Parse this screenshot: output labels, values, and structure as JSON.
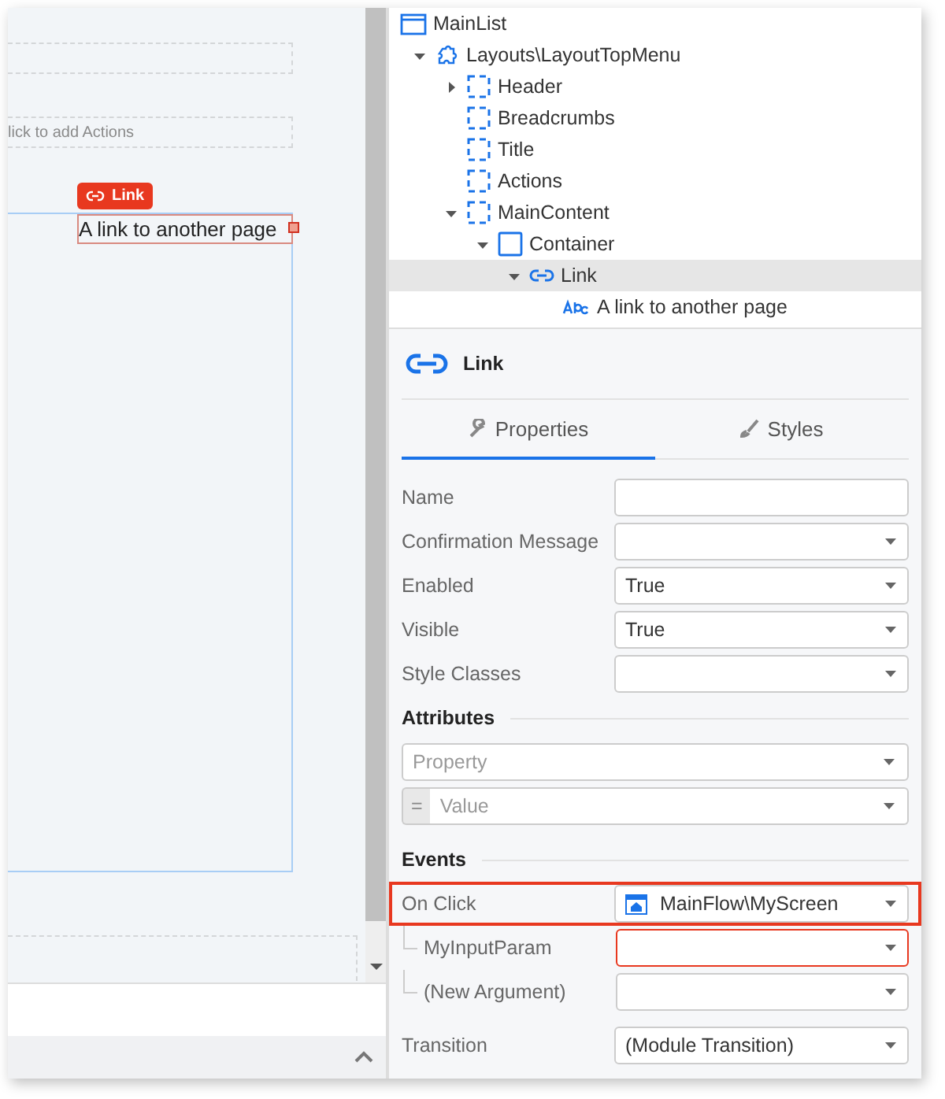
{
  "canvas": {
    "actions_hint": "lick to add Actions",
    "badge": "Link",
    "link_text": "A link to another page"
  },
  "tree": [
    {
      "label": "MainList",
      "kind": "screen",
      "selected": false,
      "children": [
        {
          "label": "Layouts\\LayoutTopMenu",
          "kind": "block",
          "expanded": true,
          "selected": false,
          "children": [
            {
              "label": "Header",
              "kind": "placeholder",
              "expanded": false,
              "selected": false
            },
            {
              "label": "Breadcrumbs",
              "kind": "placeholder",
              "selected": false
            },
            {
              "label": "Title",
              "kind": "placeholder",
              "selected": false
            },
            {
              "label": "Actions",
              "kind": "placeholder",
              "selected": false
            },
            {
              "label": "MainContent",
              "kind": "placeholder",
              "expanded": true,
              "selected": false,
              "children": [
                {
                  "label": "Container",
                  "kind": "container",
                  "expanded": true,
                  "selected": false,
                  "children": [
                    {
                      "label": "Link",
                      "kind": "link",
                      "expanded": true,
                      "selected": true,
                      "children": [
                        {
                          "label": "A link to another page",
                          "kind": "text",
                          "selected": false
                        }
                      ]
                    }
                  ]
                }
              ]
            }
          ]
        }
      ]
    }
  ],
  "selection": {
    "title": "Link"
  },
  "tabs": [
    {
      "label": "Properties",
      "selected": true
    },
    {
      "label": "Styles",
      "selected": false
    }
  ],
  "properties": [
    {
      "label": "Name",
      "kind": "text"
    },
    {
      "label": "Confirmation Message",
      "kind": "dropdown"
    },
    {
      "label": "Enabled",
      "kind": "dropdown",
      "value": "True"
    },
    {
      "label": "Visible",
      "kind": "dropdown",
      "value": "True"
    },
    {
      "label": "Style Classes",
      "kind": "dropdown"
    }
  ],
  "attributes": {
    "title": "Attributes",
    "property_placeholder": "Property",
    "value_prefix": "=",
    "value_placeholder": "Value"
  },
  "events": {
    "title": "Events",
    "on_click": {
      "label": "On Click",
      "value": "MainFlow\\MyScreen",
      "highlighted": true
    },
    "arguments": [
      {
        "label": "MyInputParam",
        "error": true
      },
      {
        "label": "(New Argument)",
        "error": false
      }
    ]
  },
  "transition": {
    "label": "Transition",
    "value": "(Module Transition)"
  }
}
